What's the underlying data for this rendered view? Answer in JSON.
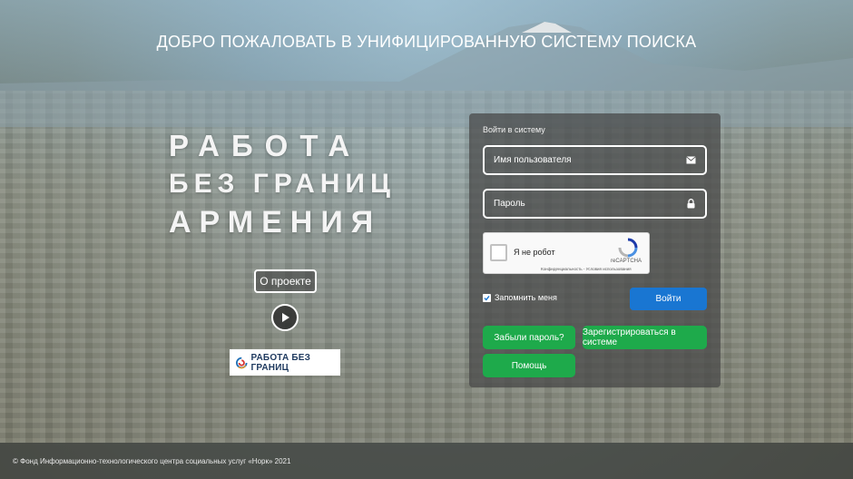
{
  "header": {
    "title": "ДОБРО ПОЖАЛОВАТЬ В УНИФИЦИРОВАННУЮ СИСТЕМУ ПОИСКА"
  },
  "brand": {
    "line1": "РАБОТА",
    "line2": "БЕЗ ГРАНИЦ",
    "line3": "АРМЕНИЯ",
    "about_label": "О проекте",
    "logo_text": "РАБОТА БЕЗ ГРАНИЦ"
  },
  "login": {
    "title": "Войти в систему",
    "username_placeholder": "Имя пользователя",
    "password_placeholder": "Пароль",
    "captcha": {
      "label": "Я не робот",
      "brand": "reCAPTCHA",
      "links": "Конфиденциальность - Условия использования"
    },
    "remember_label": "Запомнить меня",
    "remember_checked": true,
    "submit_label": "Войти",
    "forgot_label": "Забыли пароль?",
    "register_label": "Зарегистрироваться в системе",
    "help_label": "Помощь"
  },
  "footer": {
    "copyright": "© Фонд Информационно-технологического центра социальных услуг «Норк» 2021"
  },
  "colors": {
    "accent_blue": "#1976d2",
    "accent_green": "#1eaa4b",
    "panel_bg": "#464646"
  },
  "icons": {
    "username": "envelope-icon",
    "password": "lock-icon",
    "play": "play-icon"
  }
}
